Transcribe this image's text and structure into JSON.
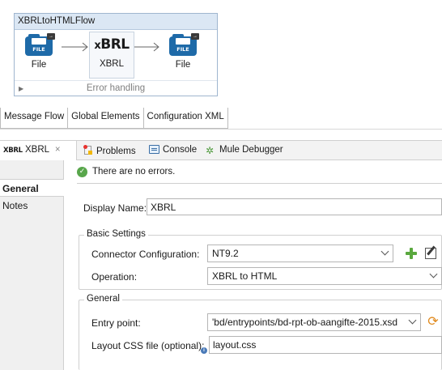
{
  "flow": {
    "title": "XBRLtoHTMLFlow",
    "nodes": [
      {
        "label": "File",
        "icon": "file-connector-icon",
        "icon_text": "FILE"
      },
      {
        "label": "XBRL",
        "icon": "xbrl-logo-icon",
        "icon_text": "XBRL"
      },
      {
        "label": "File",
        "icon": "file-connector-icon",
        "icon_text": "FILE"
      }
    ],
    "error_handling": "Error handling"
  },
  "editor_tabs": [
    "Message Flow",
    "Global Elements",
    "Configuration XML"
  ],
  "view_tabs": {
    "active": {
      "icon_text": "XBRL",
      "label": "XBRL",
      "close": "×"
    },
    "others": [
      "Problems",
      "Console",
      "Mule Debugger"
    ]
  },
  "left_nav": [
    "General",
    "Notes"
  ],
  "status": {
    "text": "There are no errors.",
    "icon": "check-circle-icon"
  },
  "display_name": {
    "label": "Display Name:",
    "value": "XBRL"
  },
  "basic_settings": {
    "title": "Basic Settings",
    "connector_label": "Connector Configuration:",
    "connector_value": "NT9.2",
    "operation_label": "Operation:",
    "operation_value": "XBRL to HTML"
  },
  "general_group": {
    "title": "General",
    "entry_label": "Entry point:",
    "entry_value": "'bd/entrypoints/bd-rpt-ob-aangifte-2015.xsd",
    "css_label": "Layout CSS file (optional):",
    "css_value": "layout.css"
  },
  "colors": {
    "flow_header": "#dbe7f4",
    "file_icon": "#1e6aa8",
    "ok_green": "#58a64b",
    "add_green": "#5aa83e"
  }
}
